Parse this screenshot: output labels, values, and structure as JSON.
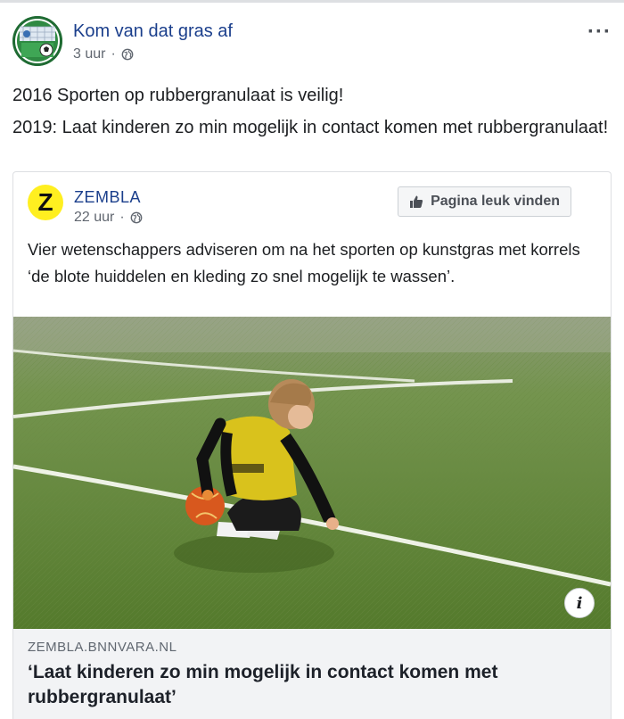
{
  "post": {
    "page_name": "Kom van dat gras af",
    "time": "3 uur",
    "separator": "·",
    "privacy_icon": "globe-icon",
    "more_icon": "more-options-icon",
    "text_lines": [
      "2016 Sporten op rubbergranulaat is veilig!",
      "2019: Laat kinderen zo min mogelijk in contact komen met rubbergranulaat!"
    ]
  },
  "shared": {
    "logo_letter": "Z",
    "page_name": "ZEMBLA",
    "time": "22 uur",
    "separator": "·",
    "like_button_label": "Pagina leuk vinden",
    "text": "Vier wetenschappers adviseren om na het sporten op kunstgras met korrels ‘de blote huiddelen en kleding zo snel mogelijk te wassen’.",
    "info_label": "i",
    "link": {
      "domain": "ZEMBLA.BNNVARA.NL",
      "title": "‘Laat kinderen zo min mogelijk in contact komen met rubbergranulaat’"
    }
  },
  "colors": {
    "link_blue": "#1b3f8c",
    "meta_gray": "#616770",
    "zembla_yellow": "#ffef20",
    "footer_bg": "#f2f3f5"
  }
}
